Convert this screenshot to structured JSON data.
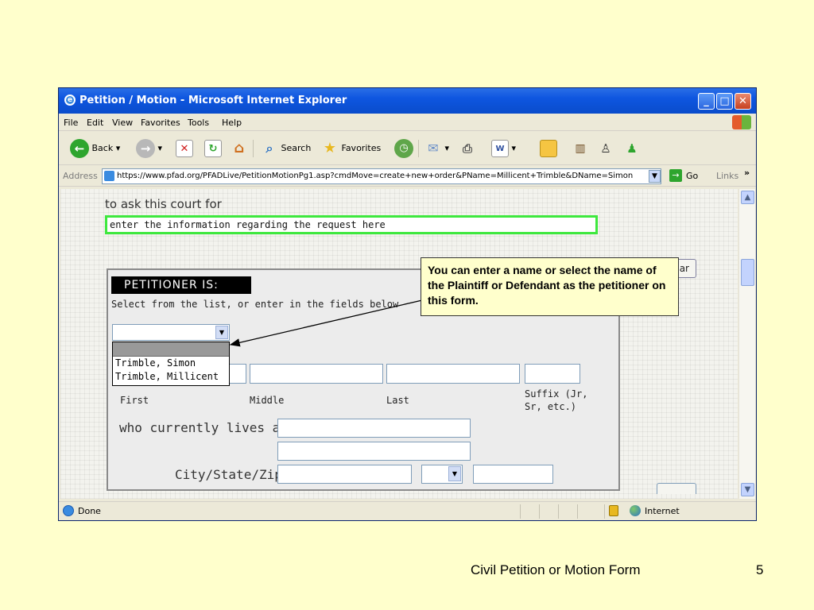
{
  "window": {
    "title": "Petition / Motion - Microsoft Internet Explorer"
  },
  "menu": {
    "items": [
      "File",
      "Edit",
      "View",
      "Favorites",
      "Tools",
      "Help"
    ]
  },
  "toolbar": {
    "back": "Back",
    "search": "Search",
    "favorites": "Favorites"
  },
  "address": {
    "label": "Address",
    "url": "https://www.pfad.org/PFADLive/PetitionMotionPg1.asp?cmdMove=create+new+order&PName=Millicent+Trimble&DName=Simon",
    "go": "Go",
    "links": "Links"
  },
  "page": {
    "ask_text": "to ask this court for",
    "request_value": "enter the information regarding the request here",
    "clear_label": "ar",
    "petitioner": {
      "header": "PETITIONER IS:",
      "instruction": "Select from the list, or enter in the fields below",
      "options": [
        "Trimble, Simon",
        "Trimble, Millicent"
      ],
      "labels": {
        "first": "First",
        "middle": "Middle",
        "last": "Last",
        "suffix": "Suffix (Jr, Sr, etc.)"
      },
      "lives_label": "who currently lives at:",
      "city_label": "City/State/Zip"
    }
  },
  "status": {
    "text": "Done",
    "zone": "Internet"
  },
  "callout": {
    "text": "You can enter a name or select the name of the Plaintiff or Defendant as the petitioner on this form."
  },
  "slide": {
    "footer": "Civil Petition or Motion Form",
    "number": "5"
  },
  "colors": {
    "background": "#FFFFCC",
    "titlebar": "#0A4CCB",
    "highlight_border": "#3EE83E"
  }
}
